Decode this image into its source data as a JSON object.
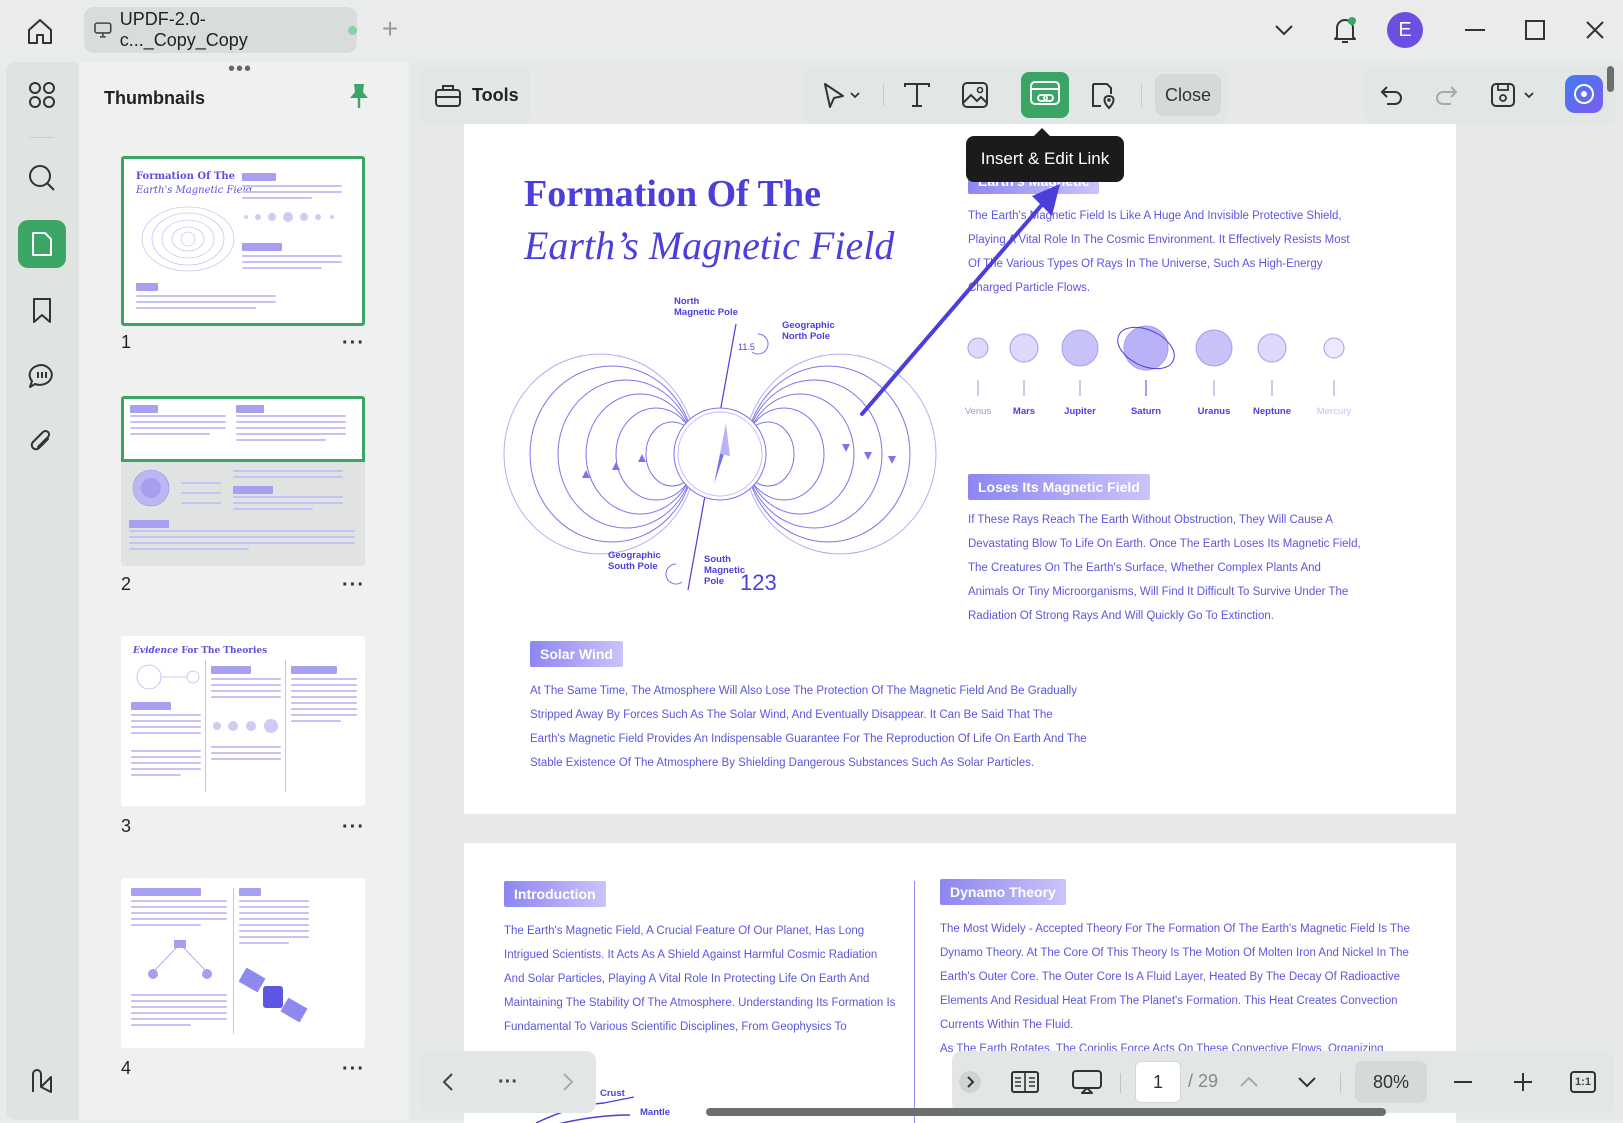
{
  "tab": {
    "title": "UPDF-2.0-c..._Copy_Copy"
  },
  "user": {
    "initial": "E"
  },
  "sidebar": {
    "title": "Thumbnails",
    "thumbnails": [
      {
        "number": "1",
        "title": "Formation Of The",
        "subtitle": "Earth's Magnetic Field"
      },
      {
        "number": "2"
      },
      {
        "number": "3",
        "title_italic": "Evidence",
        "title_rest": "For The Theories"
      },
      {
        "number": "4"
      }
    ]
  },
  "toolbar": {
    "tools_label": "Tools",
    "close_label": "Close",
    "tooltip": "Insert & Edit Link"
  },
  "page1": {
    "title_line1": "Formation Of The",
    "title_line2": "Earth’s Magnetic Field",
    "section1_tag": "Earth's Magnetic",
    "section1_body": "The Earth's Magnetic Field Is Like A Huge And Invisible Protective Shield, Playing A Vital Role In The Cosmic Environment. It Effectively Resists Most Of The Various Types Of Rays In The Universe, Such As High-Energy Charged Particle Flows.",
    "planets": [
      "Venus",
      "Mars",
      "Jupiter",
      "Saturn",
      "Uranus",
      "Neptune",
      "Mercury"
    ],
    "section2_tag": "Loses Its Magnetic Field",
    "section2_body": "If These Rays Reach The Earth Without Obstruction, They Will Cause A Devastating Blow To Life On Earth. Once The Earth Loses Its Magnetic Field, The Creatures On The Earth's Surface, Whether Complex Plants And Animals Or Tiny Microorganisms, Will Find It Difficult To Survive Under The Radiation Of Strong Rays And Will Quickly Go To Extinction.",
    "section3_tag": "Solar Wind",
    "section3_body": "At The Same Time, The Atmosphere Will Also Lose The Protection Of The Magnetic Field And Be Gradually Stripped Away By Forces Such As The Solar Wind, And Eventually Disappear. It Can Be Said That The Earth's Magnetic Field Provides An Indispensable Guarantee For The Reproduction Of Life On Earth And The Stable Existence Of The Atmosphere By Shielding Dangerous Substances Such As Solar Particles.",
    "diagram": {
      "north_magnetic": "North\nMagnetic Pole",
      "geographic_north": "Geographic\nNorth Pole",
      "geographic_south": "Geographic\nSouth Pole",
      "south_magnetic": "South\nMagnetic\nPole",
      "angle": "11.5",
      "number": "123"
    }
  },
  "page2": {
    "intro_tag": "Introduction",
    "intro_body": "The Earth's Magnetic Field, A Crucial Feature Of Our Planet, Has Long Intrigued Scientists. It Acts As A Shield Against Harmful Cosmic Radiation And Solar Particles, Playing A Vital Role In Protecting Life On Earth And Maintaining The Stability Of The Atmosphere. Understanding Its Formation Is Fundamental To Various Scientific Disciplines, From Geophysics To",
    "dynamo_tag": "Dynamo Theory",
    "dynamo_body": "The Most Widely - Accepted Theory For The Formation Of The Earth's Magnetic Field Is The Dynamo Theory. At The Core Of This Theory Is The Motion Of Molten Iron And Nickel In The Earth's Outer Core. The Outer Core Is A Fluid Layer, Heated By The Decay Of Radioactive Elements And Residual Heat From The Planet's Formation. This Heat Creates Convection Currents Within The Fluid.",
    "dynamo_more": "As The Earth Rotates, The Coriolis Force Acts On These Convective Flows, Organizing",
    "crust_label": "Crust",
    "mantle_label": "Mantle"
  },
  "statusbar": {
    "current_page": "1",
    "total_pages": "/ 29",
    "zoom": "80%",
    "fit_label": "1:1"
  },
  "colors": {
    "accent_green": "#3aa564",
    "doc_purple": "#4b3fdc",
    "avatar": "#6a4fe0"
  }
}
